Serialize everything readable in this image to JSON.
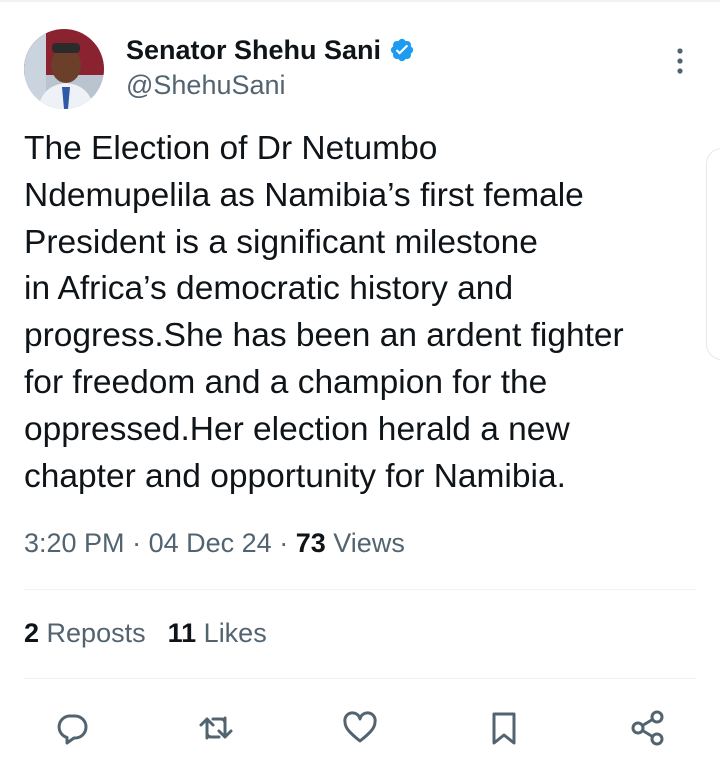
{
  "tweet": {
    "author_name": "Senator Shehu Sani",
    "author_handle": "@ShehuSani",
    "text": "The Election of Dr  Netumbo\nNdemupelila as  Namibia’s first female\nPresident is a significant milestone\nin Africa’s democratic history and\nprogress.She has been an ardent fighter\nfor freedom and a champion for the\noppressed.Her election herald a new\nchapter and opportunity for Namibia.",
    "time": "3:20 PM",
    "date": "04 Dec 24",
    "dot": "·",
    "views_count": "73",
    "views_label": "Views"
  },
  "stats": {
    "reposts_count": "2",
    "reposts_label": "Reposts",
    "likes_count": "11",
    "likes_label": "Likes"
  },
  "icons": {
    "verified": "verified-badge-icon",
    "more": "more-vertical-icon",
    "reply": "reply-icon",
    "repost": "repost-icon",
    "like": "heart-icon",
    "bookmark": "bookmark-icon",
    "share": "share-icon"
  },
  "colors": {
    "verified": "#1d9bf0",
    "icon": "#536471",
    "text": "#0f1419",
    "muted": "#536471"
  }
}
